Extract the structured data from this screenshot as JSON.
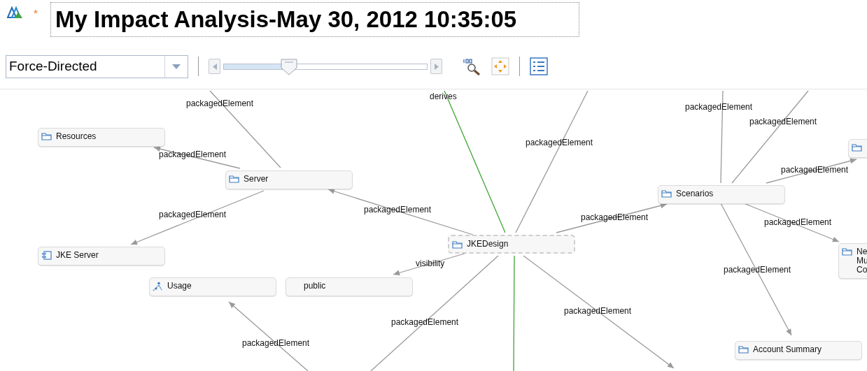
{
  "editor": {
    "modified_marker": "*",
    "title": "My Impact Analysis-May 30, 2012 10:35:05"
  },
  "toolbar": {
    "layout": "Force-Directed",
    "zoom_slider": {
      "level": 0.32
    }
  },
  "diagram": {
    "nodes": [
      {
        "kind": "folder",
        "label": "Resources",
        "selected": false
      },
      {
        "kind": "folder",
        "label": "Server",
        "selected": false
      },
      {
        "kind": "component",
        "label": "JKE Server",
        "selected": false
      },
      {
        "kind": "usage",
        "label": "Usage",
        "selected": false
      },
      {
        "kind": "plain",
        "label": "public",
        "selected": false
      },
      {
        "kind": "folder",
        "label": "JKEDesign",
        "selected": true
      },
      {
        "kind": "folder",
        "label": "Scenarios",
        "selected": false
      },
      {
        "kind": "folder",
        "label": "Account Summary",
        "selected": false
      },
      {
        "kind": "folder",
        "selected": false
      },
      {
        "kind": "folder",
        "label": "Ne\nMu\nCo",
        "selected": false
      }
    ],
    "edges": [
      {
        "color": "#9a9a9a",
        "arrow": false
      },
      {
        "color": "#9a9a9a",
        "arrow": true
      },
      {
        "color": "#9a9a9a",
        "arrow": true
      },
      {
        "color": "#9a9a9a",
        "arrow": true
      },
      {
        "color": "#3fa535",
        "arrow": false
      },
      {
        "color": "#3fa535",
        "arrow": false
      },
      {
        "color": "#9a9a9a",
        "arrow": false
      },
      {
        "color": "#9a9a9a",
        "arrow": true
      },
      {
        "color": "#9a9a9a",
        "arrow": true
      },
      {
        "color": "#9a9a9a",
        "arrow": false
      },
      {
        "color": "#9a9a9a",
        "arrow": true
      },
      {
        "color": "#9a9a9a",
        "arrow": true
      },
      {
        "color": "#9a9a9a",
        "arrow": false
      },
      {
        "color": "#9a9a9a",
        "arrow": false
      },
      {
        "color": "#9a9a9a",
        "arrow": true
      },
      {
        "color": "#9a9a9a",
        "arrow": true
      },
      {
        "color": "#9a9a9a",
        "arrow": true
      }
    ],
    "edge_labels": [
      "derives",
      "packagedElement",
      "packagedElement",
      "packagedElement",
      "packagedElement",
      "packagedElement",
      "packagedElement",
      "packagedElement",
      "packagedElement",
      "packagedElement",
      "packagedElement",
      "visibility",
      "packagedElement",
      "packagedElement",
      "packagedElement",
      "packagedElement"
    ]
  }
}
